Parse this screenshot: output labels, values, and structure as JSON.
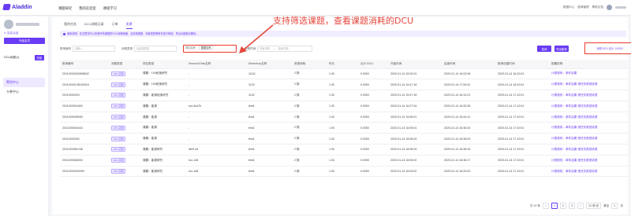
{
  "app": {
    "logo_text": "Aladdin",
    "nav": [
      "课题研究",
      "我的实验室",
      "课程学习"
    ],
    "top_right": [
      "数据中心",
      "账单管理",
      "帮助文档"
    ]
  },
  "sidebar": {
    "verified": "✔ 实名认证",
    "upgrade_label": "升级会员",
    "balance_label": "DCU余额(1)",
    "recharge_label": "充值",
    "menu": [
      {
        "label": "费用中心",
        "active": true
      },
      {
        "label": "卡券中心",
        "active": false
      }
    ]
  },
  "tabs": [
    {
      "label": "我的任务",
      "active": false
    },
    {
      "label": "DCU消耗记录",
      "active": false
    },
    {
      "label": "订单",
      "active": false
    },
    {
      "label": "发票",
      "active": true
    }
  ],
  "notice": "使用说明：在这里您可以查看所有课题的DCU消耗明细，支持按课题、消费类型等条件进行筛选，导出功能敬请期待。",
  "filters": {
    "task_label": "账单编号",
    "task_placeholder": "请输入",
    "type_label": "消费类型",
    "type_placeholder": "请选择类型",
    "project_label": "项目名称",
    "project_value": "课题名称",
    "time_label": "消费时间",
    "time_start": "开始日期",
    "time_sep": "—",
    "time_end": "结束日期",
    "query_label": "查询",
    "reset_label": "导出账单",
    "total_label": "消费 DCU 合计: 0.0318"
  },
  "annotation": "支持筛选课题，查看课题消耗的DCU",
  "table": {
    "columns": [
      "账单编号",
      "消费类型",
      "项目类型",
      "Session/Task名称",
      "Workshop名称",
      "资源消耗",
      "时长",
      "合计 DCU",
      "开始时间",
      "结束时间",
      "账单创建时间",
      "配置说明"
    ],
    "rows": [
      [
        "20110000003598632",
        "CPU 实例",
        "课题：100段落研究",
        "-",
        "11111",
        "2 核",
        "1.00",
        "0.0000",
        "2020-01-14 16:02:01",
        "2020-01-14 16:02:06",
        "2020-01-14 16:10:01",
        "计费规则：单件结果"
      ],
      [
        "20110000135163016",
        "CPU 实例",
        "课题：100段落研究",
        "-",
        "1132",
        "2 核",
        "1.00",
        "0.0000",
        "2020-01-14 15:47:18",
        "2020-01-14 17:59:42",
        "2020-01-14 18:10:01",
        "计费规则：单件结果 按任务类型收费"
      ],
      [
        "20110000004",
        "CPU 实例",
        "课题：能源段落研究",
        "-",
        "1132",
        "2 核",
        "1.00",
        "0.0000",
        "2020-01-14 15:47:18",
        "2020-01-14 16:14:21",
        "2020-01-14 17:10:01",
        "计费规则：单件结果 按任务类型收费"
      ],
      [
        "2011000004400",
        "CPU 实例",
        "课题：能源",
        "run-6cd7b",
        "test1",
        "2 核",
        "1.00",
        "0.0000",
        "2020-01-14 16:27:04",
        "2020-01-14 16:32:35",
        "2020-01-14 17:10:01",
        "计费规则：单件结果 按任务类型收费"
      ],
      [
        "2011000008090",
        "CPU 实例",
        "课题：能源",
        "-",
        "test1",
        "2 核",
        "1.00",
        "0.0000",
        "2020-01-14 16:06:01",
        "2020-01-14 16:44:12",
        "2020-01-14 17:10:01",
        "计费规则：单件结果 按任务类型收费"
      ],
      [
        "2011000004434",
        "CPU 实例",
        "课题：能源",
        "-",
        "test1",
        "2 核",
        "1.00",
        "0.0000",
        "2020-01-14 16:06:01",
        "2020-01-14 16:36:34",
        "2020-01-14 17:10:01",
        "计费规则：单件结果 按任务类型收费"
      ],
      [
        "20110000002",
        "CPU 实例",
        "课题：能源",
        "-",
        "test1",
        "2 核",
        "1.00",
        "0.0000",
        "2020-01-14 16:06:03",
        "2020-01-14 16:36:03",
        "2020-01-14 17:10:01",
        "计费规则：单件结果 按任务类型收费"
      ],
      [
        "2011000061248",
        "CPU 实例",
        "课题：能源研究",
        "dfe9-4d",
        "test1",
        "2 核",
        "1.00",
        "0.0000",
        "2020-01-14 16:06:04",
        "2020-01-14 16:36:15",
        "2020-01-14 17:10:01",
        "计费规则：单件结果 按任务类型收费"
      ],
      [
        "2011000066304",
        "CPU 实例",
        "课题：能源研究",
        "run-1d6",
        "test1",
        "2 核",
        "1.00",
        "0.0000",
        "2020-01-14 16:06:02",
        "2020-01-14 16:36:17",
        "2020-01-14 17:10:01",
        "计费规则：单件结果 按任务类型收费"
      ],
      [
        "20110000030090",
        "CPU 实例",
        "课题：能源研究",
        "run-1d6",
        "test1",
        "2 核",
        "1.00",
        "0.0000",
        "2020-01-14 16:03:02",
        "2020-01-14 16:33:02",
        "2020-01-14 17:10:01",
        "计费规则：单件结果 按任务类型收费"
      ]
    ]
  },
  "pager": {
    "total": "共 10 条",
    "prev": "‹",
    "pages": [
      "1",
      "2",
      "3"
    ],
    "next": "›",
    "size": "10 条/页",
    "goto": "跳至",
    "goto_value": "1",
    "page_unit": "页"
  },
  "colors": {
    "accent": "#6a3bf5",
    "annotation": "#e5473c"
  }
}
